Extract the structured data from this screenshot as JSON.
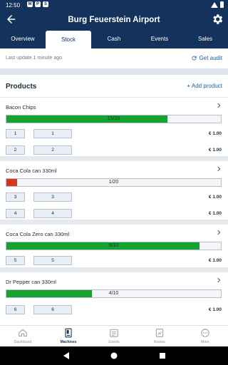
{
  "status": {
    "time": "12:50",
    "icons": [
      "M",
      "P",
      "S"
    ]
  },
  "header": {
    "title": "Burg Feuerstein Airport"
  },
  "tabs": [
    {
      "label": "Overview"
    },
    {
      "label": "Stock"
    },
    {
      "label": "Cash"
    },
    {
      "label": "Events"
    },
    {
      "label": "Sales"
    }
  ],
  "update": {
    "text": "Last update 1 minute ago",
    "audit_label": "Get audit"
  },
  "products_header": {
    "title": "Products",
    "add_label": "+ Add product"
  },
  "colors": {
    "primary": "#14335c",
    "accent": "#1e5fa8",
    "green": "#13a32e",
    "red": "#d9341e"
  },
  "products": [
    {
      "name": "Bacon Chips",
      "stock_label": "15/20",
      "fill": 0.75,
      "fill_color": "green",
      "slots": [
        {
          "slot": "1",
          "label": "1",
          "price": "€ 1.00"
        },
        {
          "slot": "2",
          "label": "2",
          "price": "€ 1.00"
        }
      ]
    },
    {
      "name": "Coca Cola can 330ml",
      "stock_label": "1/20",
      "fill": 0.05,
      "fill_color": "red",
      "slots": [
        {
          "slot": "3",
          "label": "3",
          "price": "€ 1.00"
        },
        {
          "slot": "4",
          "label": "4",
          "price": "€ 1.00"
        }
      ]
    },
    {
      "name": "Coca Cola Zero can 330ml",
      "stock_label": "9/10",
      "fill": 0.9,
      "fill_color": "green",
      "slots": [
        {
          "slot": "5",
          "label": "5",
          "price": "€ 1.00"
        }
      ]
    },
    {
      "name": "Dr Pepper can 330ml",
      "stock_label": "4/10",
      "fill": 0.4,
      "fill_color": "green",
      "slots": [
        {
          "slot": "6",
          "label": "6",
          "price": "€ 1.00"
        }
      ]
    }
  ],
  "bottom_nav": [
    {
      "label": "Dashboard",
      "icon": "home-icon"
    },
    {
      "label": "Machines",
      "icon": "machine-icon"
    },
    {
      "label": "Events",
      "icon": "events-icon"
    },
    {
      "label": "Routes",
      "icon": "routes-icon"
    },
    {
      "label": "More",
      "icon": "more-icon"
    }
  ]
}
